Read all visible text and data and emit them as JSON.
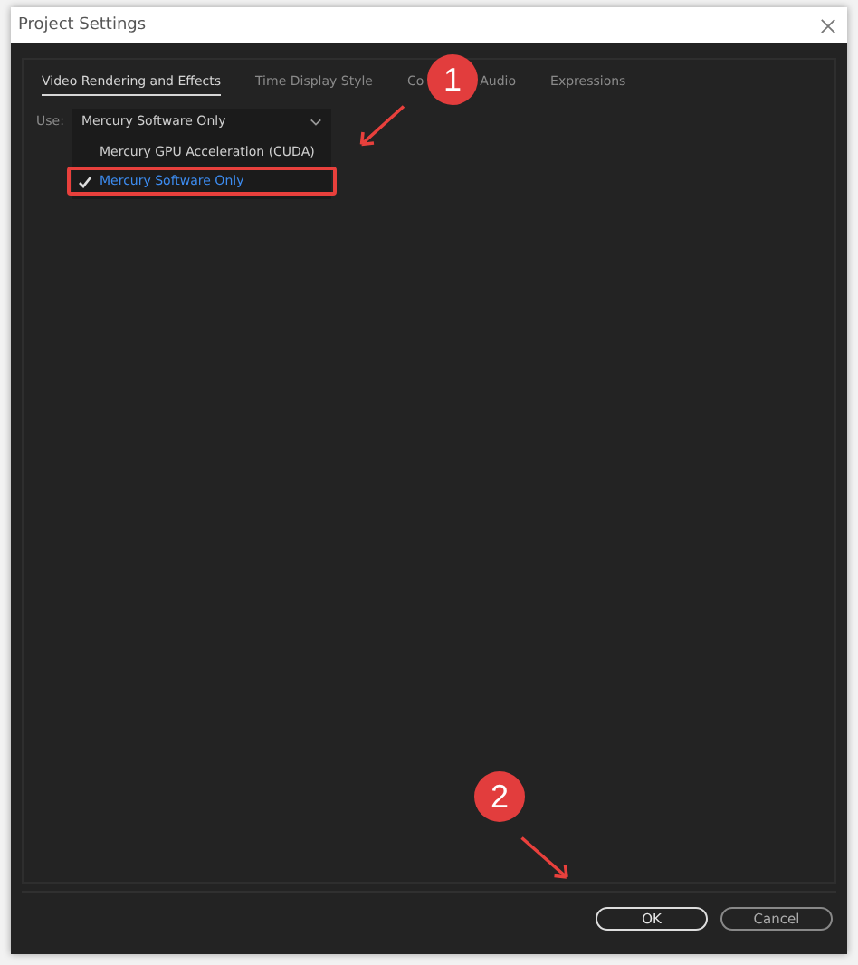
{
  "window": {
    "title": "Project Settings"
  },
  "tabs": [
    {
      "label": "Video Rendering and Effects",
      "selected": true
    },
    {
      "label": "Time Display Style",
      "selected": false
    },
    {
      "label": "Co",
      "selected": false
    },
    {
      "label": "Audio",
      "selected": false
    },
    {
      "label": "Expressions",
      "selected": false
    }
  ],
  "renderer": {
    "label": "Use:",
    "value": "Mercury Software Only",
    "options": [
      {
        "label": "Mercury GPU Acceleration (CUDA)",
        "selected": false
      },
      {
        "label": "Mercury Software Only",
        "selected": true,
        "highlighted": true
      }
    ]
  },
  "buttons": [
    {
      "label": "OK",
      "kind": "primary"
    },
    {
      "label": "Cancel",
      "kind": "secondary"
    }
  ],
  "annotations": [
    {
      "label": "1"
    },
    {
      "label": "2"
    }
  ]
}
